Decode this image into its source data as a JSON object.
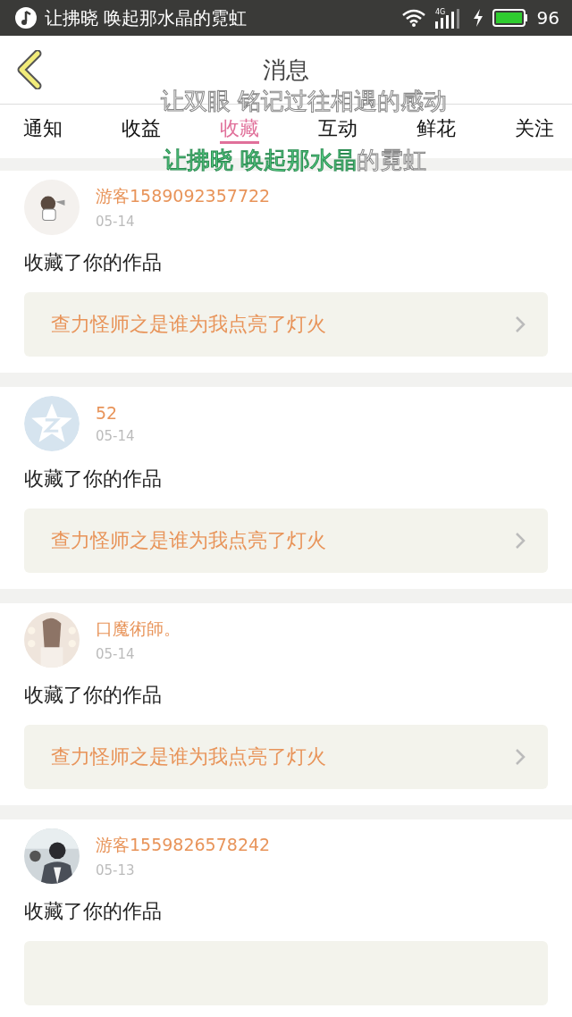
{
  "status_bar": {
    "notification": "让拂晓 唤起那水晶的霓虹",
    "network": "4G",
    "battery": "96"
  },
  "header": {
    "title": "消息"
  },
  "tabs": [
    {
      "label": "通知",
      "selected": false
    },
    {
      "label": "收益",
      "selected": false
    },
    {
      "label": "收藏",
      "selected": true
    },
    {
      "label": "互动",
      "selected": false
    },
    {
      "label": "鲜花",
      "selected": false
    },
    {
      "label": "关注",
      "selected": false
    }
  ],
  "lyrics": [
    {
      "rest": "让双眼 铭记过往相遇的感动"
    },
    {
      "sung": "让拂晓 唤起那水晶",
      "rest": "的霓虹"
    }
  ],
  "messages": [
    {
      "name": "游客1589092357722",
      "date": "05-14",
      "action": "收藏了你的作品",
      "work": "查力怪师之是谁为我点亮了灯火"
    },
    {
      "avatar": {
        "kind": "star"
      },
      "name": "52",
      "date": "05-14",
      "action": "收藏了你的作品",
      "work": "查力怪师之是谁为我点亮了灯火"
    },
    {
      "name": "口魔術師。",
      "date": "05-14",
      "action": "收藏了你的作品",
      "work": "查力怪师之是谁为我点亮了灯火"
    },
    {
      "name": "游客1559826578242",
      "date": "05-13",
      "action": "收藏了你的作品"
    }
  ]
}
